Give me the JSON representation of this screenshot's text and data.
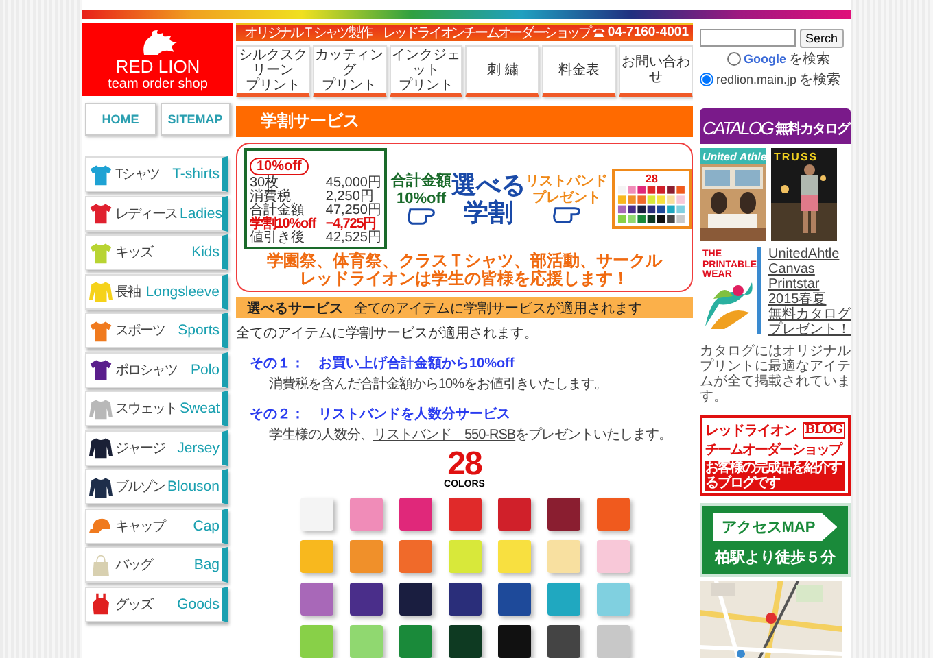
{
  "header": {
    "logo": {
      "title": "RED LION",
      "subtitle": "team order shop"
    },
    "tagline": "オリジナルＴシャツ製作　レッドライオンチームオーダーショップ",
    "phone": "04-7160-4001",
    "nav": [
      {
        "lines": [
          "シルクスクリーン",
          "プリント"
        ]
      },
      {
        "lines": [
          "カッティング",
          "プリント"
        ]
      },
      {
        "lines": [
          "インクジェット",
          "プリント"
        ]
      },
      {
        "lines": [
          "刺 繍"
        ]
      },
      {
        "lines": [
          "料金表"
        ]
      },
      {
        "lines": [
          "お問い合わせ"
        ]
      }
    ]
  },
  "search": {
    "button": "Serch",
    "options": [
      {
        "name": "Google",
        "label": "を検索",
        "kind": "logo",
        "selected": false
      },
      {
        "name": "redlion.main.jp",
        "label": "を検索",
        "kind": "text",
        "selected": true
      }
    ]
  },
  "sidebar": {
    "links": [
      "HOME",
      "SITEMAP"
    ],
    "categories": [
      {
        "label": "Tシャツ",
        "label_en": "T-shirts",
        "kind": "tee",
        "color": "#1ea2d4"
      },
      {
        "label": "レディース",
        "label_en": "Ladies",
        "kind": "tee",
        "color": "#e0202e"
      },
      {
        "label": "キッズ",
        "label_en": "Kids",
        "kind": "tee",
        "color": "#b8d432"
      },
      {
        "label": "長袖",
        "label_en": "Longsleeve",
        "kind": "longsleeve",
        "color": "#f5d21a"
      },
      {
        "label": "スポーツ",
        "label_en": "Sports",
        "kind": "tee",
        "color": "#f07a1e"
      },
      {
        "label": "ポロシャツ",
        "label_en": "Polo",
        "kind": "tee",
        "color": "#5a1e8c"
      },
      {
        "label": "スウェット",
        "label_en": "Sweat",
        "kind": "longsleeve",
        "color": "#b8b8b8"
      },
      {
        "label": "ジャージ",
        "label_en": "Jersey",
        "kind": "longsleeve",
        "color": "#1a2036"
      },
      {
        "label": "ブルゾン",
        "label_en": "Blouson",
        "kind": "longsleeve",
        "color": "#1e2e4a"
      },
      {
        "label": "キャップ",
        "label_en": "Cap",
        "kind": "cap",
        "color": "#f07a1e"
      },
      {
        "label": "バッグ",
        "label_en": "Bag",
        "kind": "bag",
        "color": "#d8d0b0"
      },
      {
        "label": "グッズ",
        "label_en": "Goods",
        "kind": "apron",
        "color": "#e02020"
      }
    ]
  },
  "main": {
    "title": "学割サービス",
    "banner": {
      "badge": "10%off",
      "price_rows": [
        {
          "label": "30枚",
          "amount": "45,000円",
          "kind": "normal"
        },
        {
          "label": "消費税",
          "amount": "2,250円",
          "kind": "normal"
        },
        {
          "label": "合計金額",
          "amount": "47,250円",
          "kind": "normal"
        },
        {
          "label": "学割10%off",
          "amount": "−4,725円",
          "kind": "discount"
        },
        {
          "label": "値引き後",
          "amount": "42,525円",
          "kind": "normal"
        }
      ],
      "total_label": "合計金額",
      "total_value": "10%off",
      "headline": [
        "選べる",
        "学割"
      ],
      "gift": [
        "リストバンド",
        "プレゼント"
      ],
      "color_count": "28",
      "slogan": [
        "学園祭、体育祭、クラスＴシャツ、部活動、サークル",
        "レッドライオンは学生の皆様を応援します！"
      ]
    },
    "section": {
      "title": "選べるサービス",
      "text": "全てのアイテムに学割サービスが適用されます"
    },
    "intro": "全てのアイテムに学割サービスが適用されます。",
    "items": [
      {
        "number": "その１：",
        "title": "お買い上げ合計金額から10%off",
        "text_before": "消費税を含んだ合計金額から10%をお値引きいたします。"
      },
      {
        "number": "その２：",
        "title": "リストバンドを人数分サービス",
        "text_before": "学生様の人数分、",
        "link": "リストバンド　550-RSB",
        "text_after": "をプレゼントいたします。"
      }
    ],
    "colors": {
      "count": "28",
      "label": "COLORS",
      "swatches": [
        {
          "color": "#f4f4f4"
        },
        {
          "color": "#f08cb8"
        },
        {
          "color": "#e0287a"
        },
        {
          "color": "#e02a2a"
        },
        {
          "color": "#d0202a"
        },
        {
          "color": "#8a1e30"
        },
        {
          "color": "#f05a1e"
        },
        {
          "color": "#f8b81e"
        },
        {
          "color": "#f0902a"
        },
        {
          "color": "#f06a2a"
        },
        {
          "color": "#d8e83a"
        },
        {
          "color": "#f8e040"
        },
        {
          "color": "#f8e0a0"
        },
        {
          "color": "#f8c8d8"
        },
        {
          "color": "#a868b8"
        },
        {
          "color": "#4a2e8a"
        },
        {
          "color": "#1a1e40"
        },
        {
          "color": "#2a2e7a"
        },
        {
          "color": "#1e4a9a"
        },
        {
          "color": "#20a8c0"
        },
        {
          "color": "#80d0e0"
        },
        {
          "color": "#88d048"
        },
        {
          "color": "#90d870"
        },
        {
          "color": "#1a8a3a"
        },
        {
          "color": "#0e3a22"
        },
        {
          "color": "#111111"
        },
        {
          "color": "#444444"
        },
        {
          "color": "#c8c8c8"
        }
      ]
    }
  },
  "aside": {
    "catalog": {
      "title": "CATALOG",
      "subtitle": "無料カタログ",
      "covers": [
        {
          "title": "United Athle"
        },
        {
          "title": "TRUSS"
        }
      ],
      "feature": {
        "title": "THE PRINTABLE WEAR",
        "link": [
          "UnitedAhtle",
          "Canvas",
          "Printstar",
          "2015春夏",
          "無料カタログ",
          "プレゼント！"
        ]
      },
      "note": "カタログにはオリジナルプリントに最適なアイテムが全て掲載されています。"
    },
    "blog": {
      "title": "レッドライオン",
      "tag": "BLOG",
      "subtitle": "チームオーダーショップ",
      "caption": "お客様の完成品を紹介するブログです"
    },
    "access": {
      "title": "アクセスMAP",
      "caption": "柏駅より徒歩５分"
    }
  }
}
